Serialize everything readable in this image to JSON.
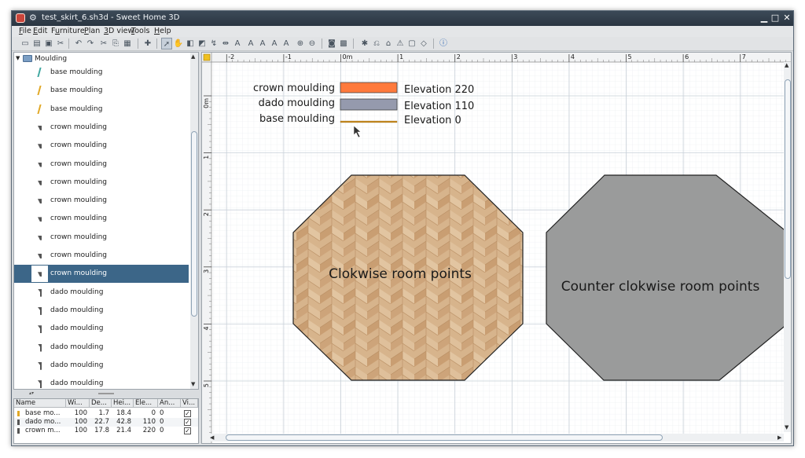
{
  "window": {
    "title": "test_skirt_6.sh3d - Sweet Home 3D"
  },
  "menu": [
    {
      "pre": "",
      "u": "F",
      "post": "ile"
    },
    {
      "pre": "",
      "u": "E",
      "post": "dit"
    },
    {
      "pre": "F",
      "u": "u",
      "post": "rniture"
    },
    {
      "pre": "",
      "u": "P",
      "post": "lan"
    },
    {
      "pre": "",
      "u": "3",
      "post": "D view"
    },
    {
      "pre": "",
      "u": "T",
      "post": "ools"
    },
    {
      "pre": "",
      "u": "H",
      "post": "elp"
    }
  ],
  "catalog": {
    "category": "Moulding",
    "items": [
      {
        "label": "base moulding",
        "icon": "base-moulding-icon",
        "color": "#3fa7a0"
      },
      {
        "label": "base moulding",
        "icon": "base-moulding-icon",
        "color": "#e1a826"
      },
      {
        "label": "base moulding",
        "icon": "base-moulding-icon",
        "color": "#e1a826"
      },
      {
        "label": "crown moulding",
        "icon": "crown-moulding-icon",
        "color": "#555555"
      },
      {
        "label": "crown moulding",
        "icon": "crown-moulding-icon",
        "color": "#555555"
      },
      {
        "label": "crown moulding",
        "icon": "crown-moulding-icon",
        "color": "#555555"
      },
      {
        "label": "crown moulding",
        "icon": "crown-moulding-icon",
        "color": "#555555"
      },
      {
        "label": "crown moulding",
        "icon": "crown-moulding-icon",
        "color": "#555555"
      },
      {
        "label": "crown moulding",
        "icon": "crown-moulding-icon",
        "color": "#555555"
      },
      {
        "label": "crown moulding",
        "icon": "crown-moulding-icon",
        "color": "#555555"
      },
      {
        "label": "crown moulding",
        "icon": "crown-moulding-icon",
        "color": "#555555"
      },
      {
        "label": "crown moulding",
        "icon": "crown-moulding-icon",
        "color": "#555555",
        "selected": true
      },
      {
        "label": "dado moulding",
        "icon": "dado-moulding-icon",
        "color": "#555555"
      },
      {
        "label": "dado moulding",
        "icon": "dado-moulding-icon",
        "color": "#555555"
      },
      {
        "label": "dado moulding",
        "icon": "dado-moulding-icon",
        "color": "#555555"
      },
      {
        "label": "dado moulding",
        "icon": "dado-moulding-icon",
        "color": "#555555"
      },
      {
        "label": "dado moulding",
        "icon": "dado-moulding-icon",
        "color": "#555555"
      },
      {
        "label": "dado moulding",
        "icon": "dado-moulding-icon",
        "color": "#555555"
      }
    ]
  },
  "furniture_table": {
    "columns": [
      "Name",
      "Wi...",
      "De...",
      "Hei...",
      "Ele...",
      "An...",
      "Vi..."
    ],
    "rows": [
      {
        "name": "base mo...",
        "width": "100",
        "depth": "1.7",
        "height": "18.4",
        "elevation": "0",
        "angle": "0",
        "visible": "✓"
      },
      {
        "name": "dado mo...",
        "width": "100",
        "depth": "22.7",
        "height": "42.8",
        "elevation": "110",
        "angle": "0",
        "visible": "✓"
      },
      {
        "name": "crown m...",
        "width": "100",
        "depth": "17.8",
        "height": "21.4",
        "elevation": "220",
        "angle": "0",
        "visible": "✓"
      }
    ]
  },
  "plan": {
    "ruler_x": [
      "-2",
      "-1",
      "0m",
      "1",
      "2",
      "3",
      "4",
      "5",
      "6",
      "7"
    ],
    "ruler_y": [
      "0m",
      "1",
      "2",
      "3",
      "4",
      "5"
    ],
    "legend": [
      {
        "label": "crown moulding",
        "elevation": "Elevation 220",
        "color": "#ff7a3c"
      },
      {
        "label": "dado moulding",
        "elevation": "Elevation 110",
        "color": "#959aad"
      },
      {
        "label": "base moulding",
        "elevation": "Elevation 0",
        "color": "#c88a20"
      }
    ],
    "rooms": [
      {
        "label": "Clokwise room points",
        "fill": "parquet"
      },
      {
        "label": "Counter clokwise room points",
        "fill": "#9a9b9b"
      }
    ]
  },
  "colors": {
    "selection": "#3c6688",
    "titlebar": "#2f3b47",
    "parquet_light": "#d9b48c",
    "parquet_dark": "#c49a6d"
  }
}
